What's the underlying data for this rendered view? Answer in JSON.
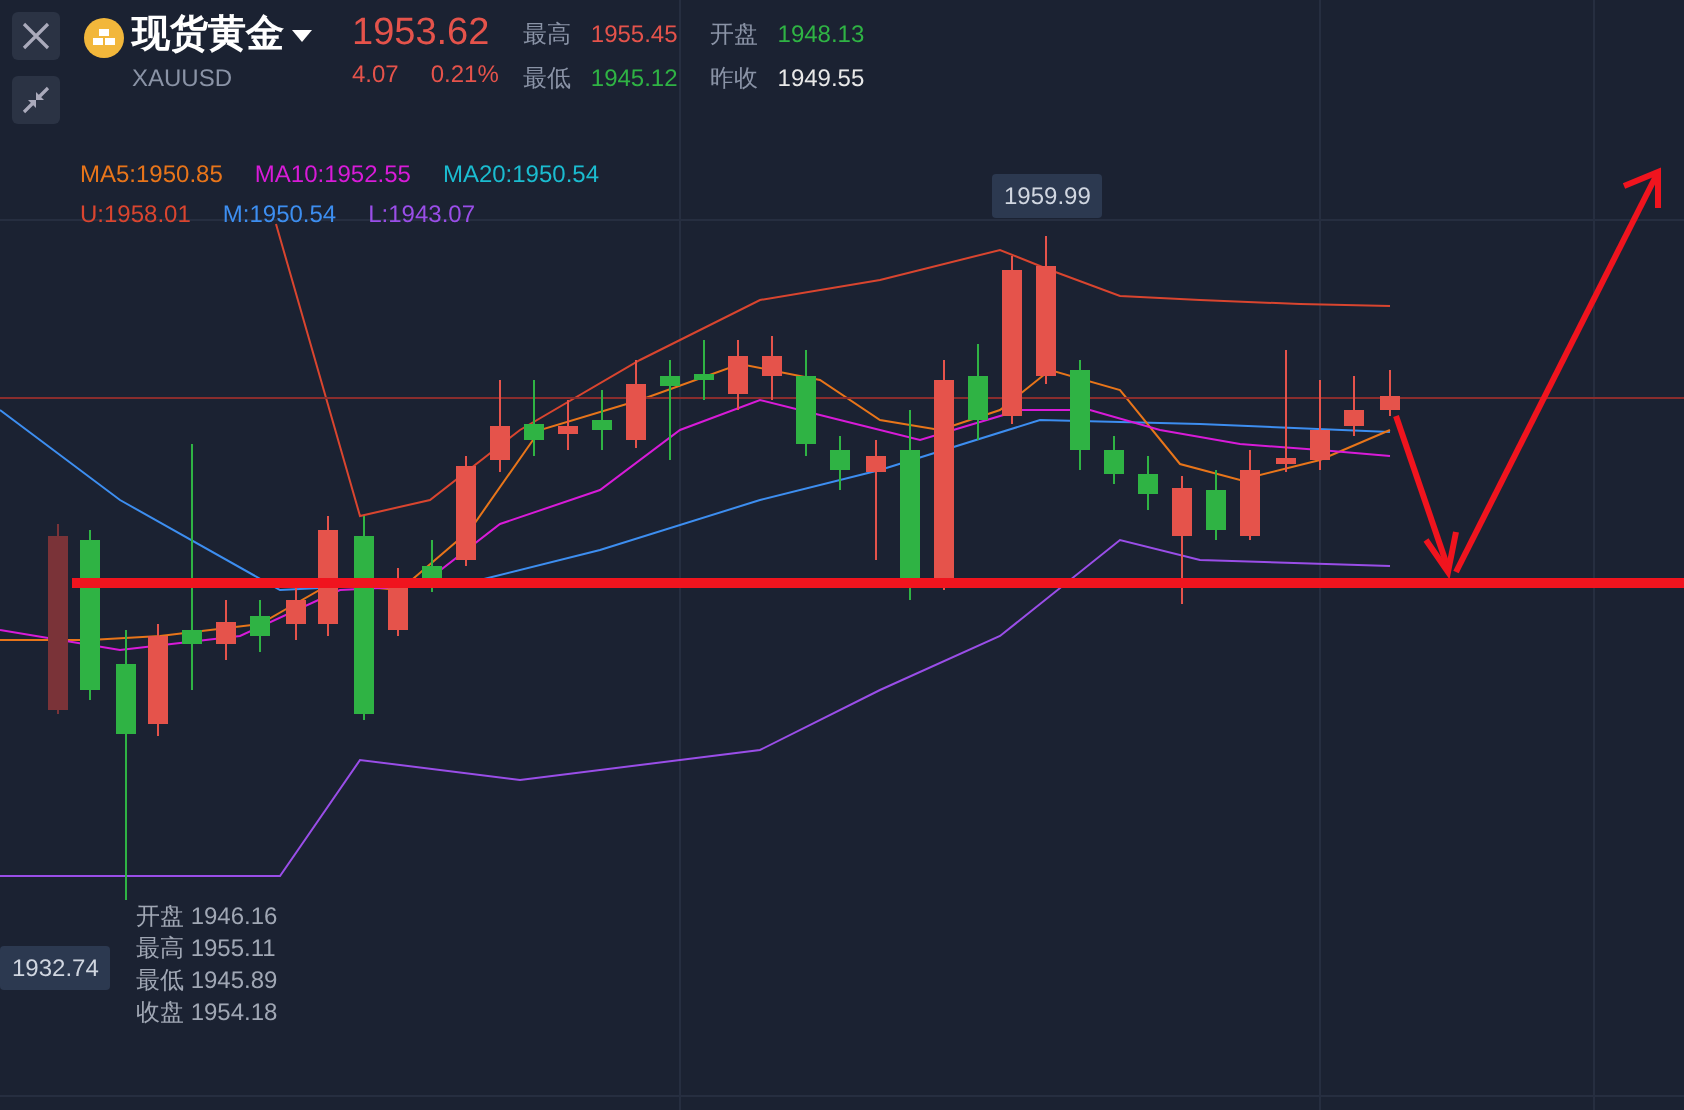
{
  "instrument": {
    "name": "现货黄金",
    "symbol": "XAUUSD",
    "price": "1953.62",
    "change": "4.07",
    "change_pct": "0.21%"
  },
  "stats": [
    {
      "label": "最高",
      "value": "1955.45",
      "color": "#e5534b"
    },
    {
      "label": "开盘",
      "value": "1948.13",
      "color": "#2fb344"
    },
    {
      "label": "最低",
      "value": "1945.12",
      "color": "#2fb344"
    },
    {
      "label": "昨收",
      "value": "1949.55",
      "color": "#e8e8e8"
    }
  ],
  "indicators": [
    [
      {
        "text": "MA5:1950.85",
        "color": "#e8751a"
      },
      {
        "text": "MA10:1952.55",
        "color": "#d81bd8"
      },
      {
        "text": "MA20:1950.54",
        "color": "#1bbcd0"
      }
    ],
    [
      {
        "text": "U:1958.01",
        "color": "#d9452f"
      },
      {
        "text": "M:1950.54",
        "color": "#3d8ef0"
      },
      {
        "text": "L:1943.07",
        "color": "#9a4ee8"
      }
    ]
  ],
  "high_marker": "1959.99",
  "low_marker": "1932.74",
  "tooltip": [
    {
      "label": "开盘",
      "value": "1946.16"
    },
    {
      "label": "最高",
      "value": "1955.11"
    },
    {
      "label": "最低",
      "value": "1945.89"
    },
    {
      "label": "收盘",
      "value": "1954.18"
    }
  ]
}
